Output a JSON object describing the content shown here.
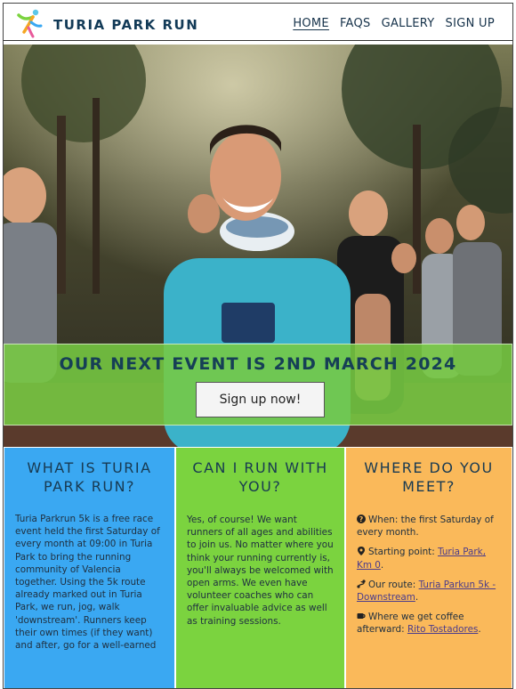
{
  "header": {
    "brand": "TURIA PARK RUN",
    "nav": [
      {
        "label": "HOME",
        "active": true
      },
      {
        "label": "FAQS",
        "active": false
      },
      {
        "label": "GALLERY",
        "active": false
      },
      {
        "label": "SIGN UP",
        "active": false
      }
    ]
  },
  "hero": {
    "image": "group-of-runners-photo",
    "banner_title": "OUR NEXT EVENT IS 2ND MARCH 2024",
    "signup_button": "Sign up now!"
  },
  "sections": {
    "what": {
      "title": "WHAT IS TURIA PARK RUN?",
      "body": "Turia Parkrun 5k is a free race event held the first Saturday of every month at 09:00 in Turia Park to bring the running community of Valencia together. Using the 5k route already marked out in Turia Park, we run, jog, walk 'downstream'. Runners keep their own times (if they want) and after, go for a well-earned"
    },
    "can": {
      "title": "CAN I RUN WITH YOU?",
      "body": "Yes, of course! We want runners of all ages and abilities to join us. No matter where you think your running currently is, you'll always be welcomed with open arms. We even have volunteer coaches who can offer invaluable advice as well as training sessions."
    },
    "where": {
      "title": "WHERE DO YOU MEET?",
      "when": {
        "icon": "question-circle-icon",
        "text": "When: the first Saturday of every month."
      },
      "start": {
        "icon": "map-pin-icon",
        "prefix": "Starting point: ",
        "link": "Turia Park, Km 0",
        "suffix": "."
      },
      "route": {
        "icon": "route-icon",
        "prefix": "Our route: ",
        "link": "Turia Parkun 5k - Downstream",
        "suffix": "."
      },
      "coffee": {
        "icon": "coffee-cup-icon",
        "prefix": "Where we get coffee afterward: ",
        "link": "Rito Tostadores",
        "suffix": "."
      }
    }
  },
  "colors": {
    "blue": "#3aa8f2",
    "green": "#7bd33f",
    "orange": "#fab95a",
    "heading": "#183a52"
  }
}
